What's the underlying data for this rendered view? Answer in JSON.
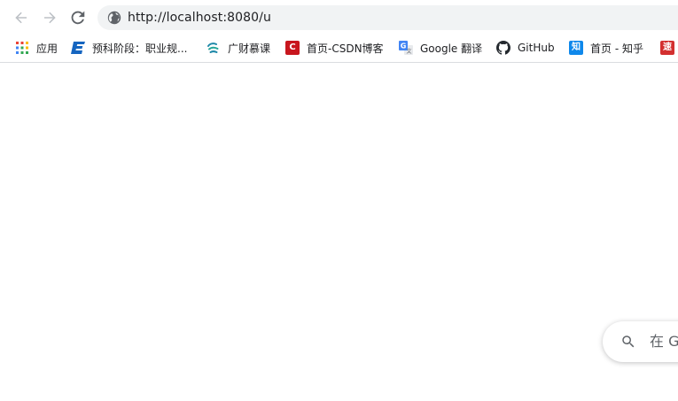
{
  "toolbar": {
    "url": "http://localhost:8080/u"
  },
  "bookmarks": [
    {
      "label": "应用",
      "icon": "apps-grid-icon"
    },
    {
      "label": "预科阶段：职业规...",
      "icon": "blue-e-icon"
    },
    {
      "label": "广财慕课",
      "icon": "swirl-logo-icon"
    },
    {
      "label": "首页-CSDN博客",
      "icon": "csdn-icon",
      "badge": "C"
    },
    {
      "label": "Google 翻译",
      "icon": "google-translate-icon"
    },
    {
      "label": "GitHub",
      "icon": "github-icon"
    },
    {
      "label": "首页 - 知乎",
      "icon": "zhihu-icon",
      "badge": "知"
    },
    {
      "label": "",
      "icon": "speed-icon",
      "badge": "速"
    }
  ],
  "search": {
    "text": "在 G"
  },
  "colors": {
    "omnibox_bg": "#f1f3f4",
    "nav_icon": "#5f6368",
    "csdn_red": "#c8161e",
    "zhihu_blue": "#0f88eb",
    "speed_red": "#d32f2f"
  }
}
